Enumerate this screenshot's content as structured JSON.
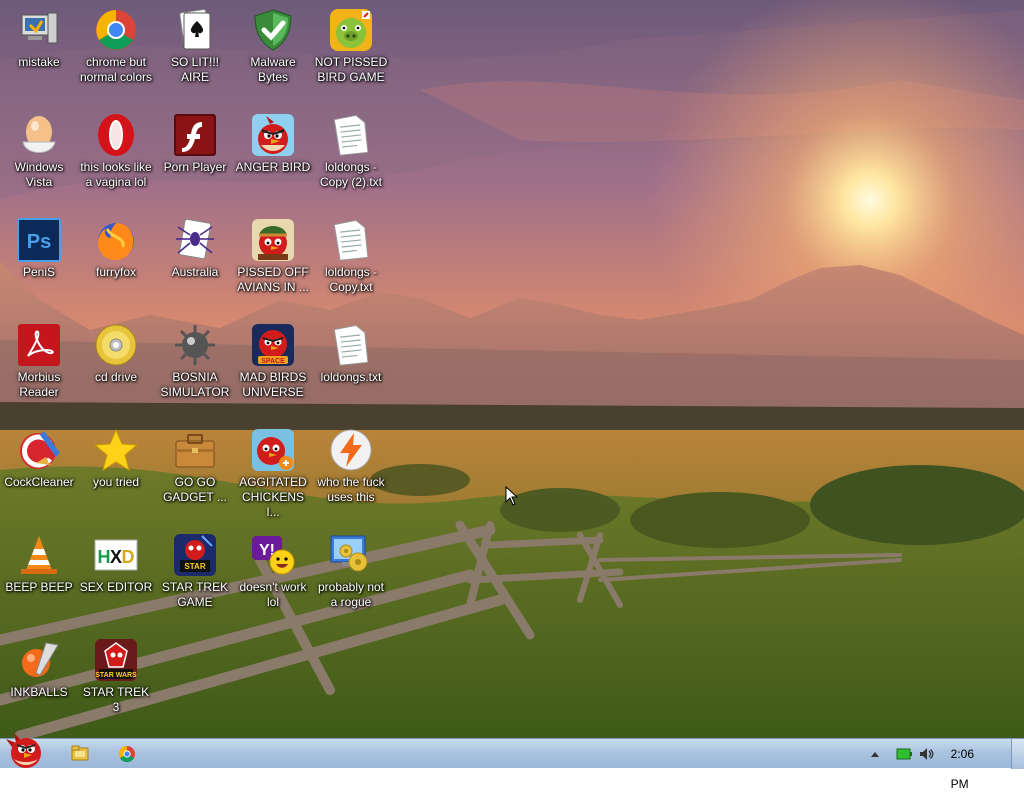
{
  "desktop": {
    "icons": [
      {
        "label": "mistake",
        "icon": "computer-icon"
      },
      {
        "label": "chrome but normal colors",
        "icon": "chrome-icon"
      },
      {
        "label": "SO LIT!!! AIRE",
        "icon": "solitaire-icon"
      },
      {
        "label": "Malware Bytes",
        "icon": "shield-icon"
      },
      {
        "label": "NOT PISSED BIRD GAME",
        "icon": "pig-icon"
      },
      {
        "label": "Windows Vista",
        "icon": "egg-icon"
      },
      {
        "label": "this looks like a vagina lol",
        "icon": "opera-icon"
      },
      {
        "label": "Porn Player",
        "icon": "flash-icon"
      },
      {
        "label": "ANGER BIRD",
        "icon": "angry-bird-icon"
      },
      {
        "label": "loldongs - Copy (2).txt",
        "icon": "text-file-icon"
      },
      {
        "label": "PeniS",
        "icon": "photoshop-icon"
      },
      {
        "label": "furryfox",
        "icon": "firefox-icon"
      },
      {
        "label": "Australia",
        "icon": "spider-solitaire-icon"
      },
      {
        "label": "PISSED OFF AVIANS IN ...",
        "icon": "angry-birds-seasons-icon"
      },
      {
        "label": "loldongs - Copy.txt",
        "icon": "text-file-icon"
      },
      {
        "label": "Morbius Reader",
        "icon": "acrobat-icon"
      },
      {
        "label": "cd drive",
        "icon": "cd-icon"
      },
      {
        "label": "BOSNIA SIMULATOR",
        "icon": "mine-icon"
      },
      {
        "label": "MAD BIRDS UNIVERSE",
        "icon": "angry-birds-space-icon"
      },
      {
        "label": "loldongs.txt",
        "icon": "text-file-icon"
      },
      {
        "label": "CockCleaner",
        "icon": "ccleaner-icon"
      },
      {
        "label": "you tried",
        "icon": "star-icon"
      },
      {
        "label": "GO GO GADGET ...",
        "icon": "briefcase-icon"
      },
      {
        "label": "AGGITATED CHICKENS I...",
        "icon": "angry-birds-rio-icon"
      },
      {
        "label": "who the fuck uses this",
        "icon": "lightning-icon"
      },
      {
        "label": "BEEP BEEP",
        "icon": "vlc-cone-icon"
      },
      {
        "label": "SEX EDITOR",
        "icon": "hxd-icon"
      },
      {
        "label": "STAR TREK GAME",
        "icon": "star-wars-bird-icon"
      },
      {
        "label": "doesn't work lol",
        "icon": "yahoo-messenger-icon"
      },
      {
        "label": "probably not a rogue",
        "icon": "control-panel-icon"
      },
      {
        "label": "INKBALLS",
        "icon": "inkball-icon"
      },
      {
        "label": "STAR TREK 3",
        "icon": "star-wars-2-icon"
      }
    ]
  },
  "taskbar": {
    "start_icon": "angry-bird-start-icon",
    "pinned": [
      {
        "name": "explorer-icon"
      },
      {
        "name": "chrome-icon"
      }
    ],
    "tray": {
      "clock": "2:06 PM",
      "icons": [
        "show-hidden-icon",
        "battery-icon",
        "volume-icon"
      ]
    }
  }
}
